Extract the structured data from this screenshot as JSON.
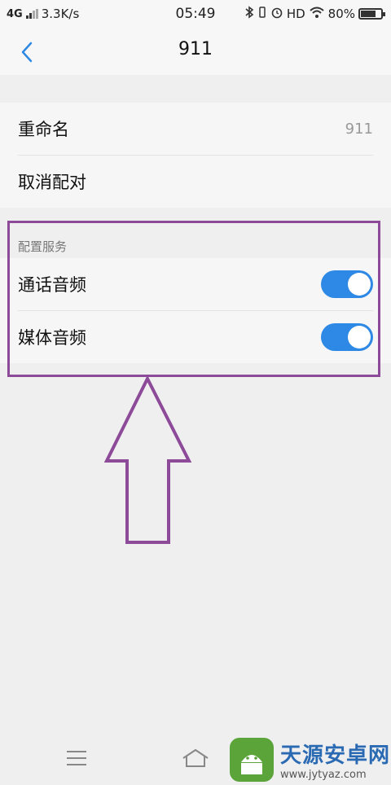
{
  "status_bar": {
    "network": "4G",
    "speed": "3.3K/s",
    "time": "05:49",
    "hd": "HD",
    "battery": "80%",
    "battery_level": 0.8
  },
  "header": {
    "back_icon": "chevron-left-icon",
    "title": "911"
  },
  "device_group": {
    "rename_label": "重命名",
    "rename_value": "911",
    "unpair_label": "取消配对"
  },
  "services": {
    "section_label": "配置服务",
    "items": [
      {
        "label": "通话音频",
        "enabled": true
      },
      {
        "label": "媒体音频",
        "enabled": true
      }
    ]
  },
  "colors": {
    "accent": "#2d89e5",
    "annotation": "#8c4a98"
  },
  "watermark": {
    "name": "天源安卓网",
    "url": "www.jytyaz.com"
  }
}
